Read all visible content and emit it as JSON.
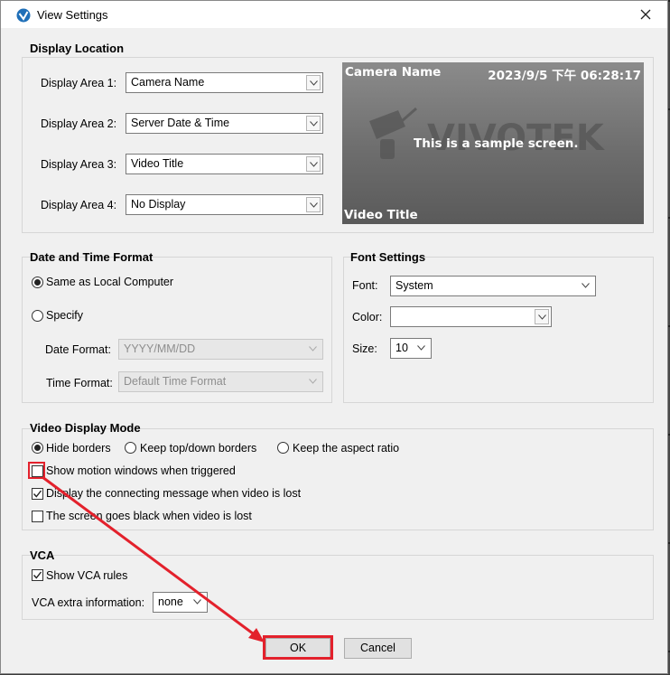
{
  "window": {
    "title": "View Settings"
  },
  "display_location": {
    "title": "Display Location",
    "areas": [
      {
        "label": "Display Area 1:",
        "value": "Camera Name"
      },
      {
        "label": "Display Area 2:",
        "value": "Server Date & Time"
      },
      {
        "label": "Display Area 3:",
        "value": "Video Title"
      },
      {
        "label": "Display Area 4:",
        "value": "No Display"
      }
    ],
    "preview": {
      "top_left": "Camera Name",
      "top_right": "2023/9/5 下午 06:28:17",
      "center": "This is a sample screen.",
      "bottom_left": "Video Title",
      "watermark_icon": "vivotek-logo-watermark"
    }
  },
  "date_time": {
    "title": "Date and Time Format",
    "option_same": "Same as Local Computer",
    "option_specify": "Specify",
    "selected": "same",
    "date_label": "Date Format:",
    "date_value": "YYYY/MM/DD",
    "time_label": "Time Format:",
    "time_value": "Default Time Format"
  },
  "font": {
    "title": "Font Settings",
    "font_label": "Font:",
    "font_value": "System",
    "color_label": "Color:",
    "color_value": "",
    "size_label": "Size:",
    "size_value": "10"
  },
  "video_display": {
    "title": "Video Display Mode",
    "modes": [
      "Hide borders",
      "Keep top/down borders",
      "Keep the aspect ratio"
    ],
    "selected_mode": "Hide borders",
    "checks": [
      {
        "label": "Show motion windows when triggered",
        "checked": false
      },
      {
        "label": "Display the connecting message when video is lost",
        "checked": true
      },
      {
        "label": "The screen goes black when video is lost",
        "checked": false
      }
    ]
  },
  "vca": {
    "title": "VCA",
    "show_rules_label": "Show VCA rules",
    "show_rules_checked": true,
    "extra_label": "VCA extra information:",
    "extra_value": "none"
  },
  "buttons": {
    "ok": "OK",
    "cancel": "Cancel"
  },
  "annotation": {
    "color": "#e3212c"
  }
}
